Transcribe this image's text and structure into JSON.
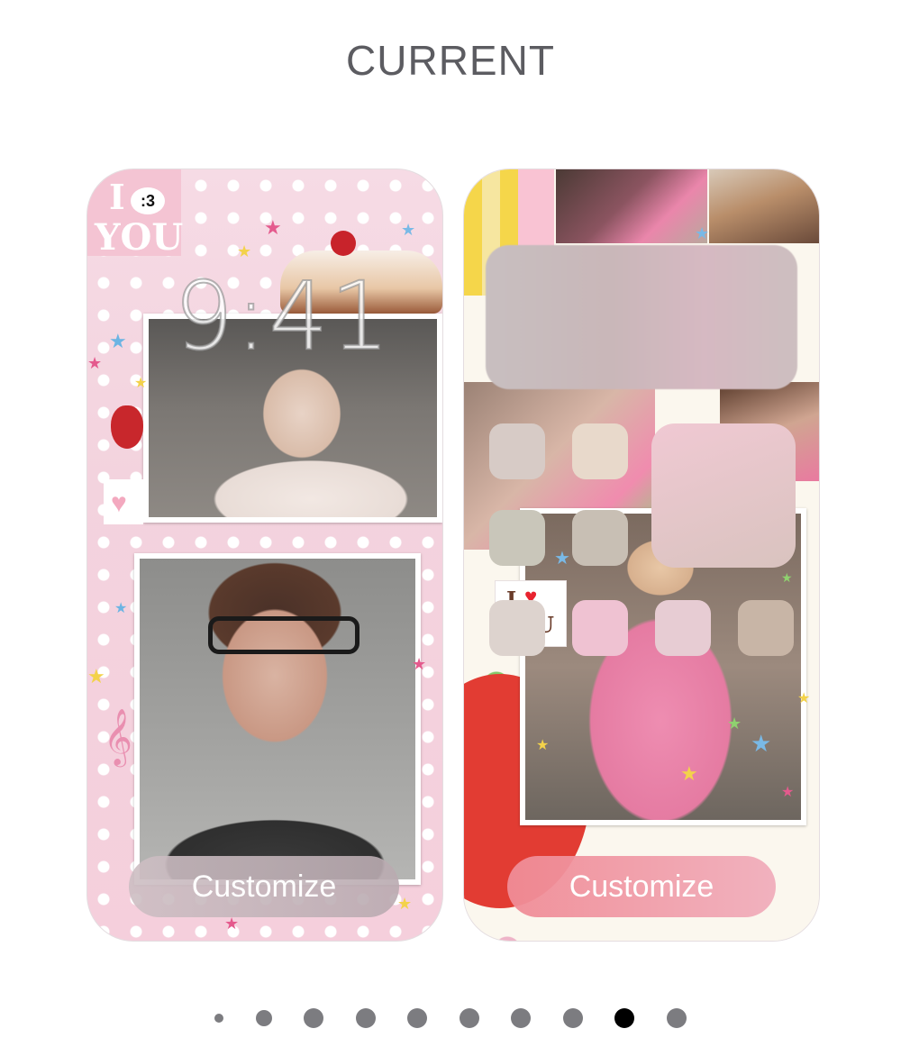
{
  "header": {
    "title": "CURRENT"
  },
  "lock_screen": {
    "time": "9:41",
    "badge": ":3",
    "sticker_text_top": "I",
    "sticker_text_you": "YOU",
    "customize_label": "Customize"
  },
  "home_screen": {
    "sticker_text": "I",
    "sticker_text_2": "U",
    "customize_label": "Customize"
  },
  "pager": {
    "count": 10,
    "active_index": 8
  },
  "colors": {
    "title": "#5c5c61",
    "active_dot": "#000000",
    "inactive_dot": "#7c7c80"
  }
}
